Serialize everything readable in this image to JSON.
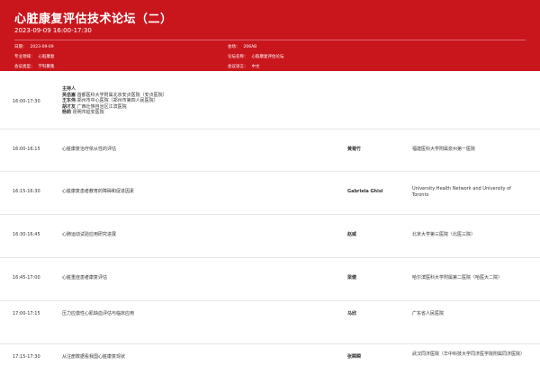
{
  "header": {
    "title": "心脏康复评估技术论坛（二）",
    "datetime": "2023-09-09   16:00-17:30",
    "date_label": "日期：",
    "date_value": "2023-09-09",
    "room_label": "会场：",
    "room_value": "206AB",
    "field_label": "专业领域：",
    "field_value": "心脏康复",
    "forum_label": "论坛名称：",
    "forum_value": "心脏康复评估论坛",
    "type_label": "会议类型：",
    "type_value": "学科聚集",
    "lang_label": "会议语言：",
    "lang_value": "中文"
  },
  "host_block": {
    "time": "16:00-17:30",
    "label": "主持人",
    "hosts": [
      {
        "name": "吴岳嵩",
        "org": "首都医科大学附属北京安贞医院（安贞医院）"
      },
      {
        "name": "王东伟",
        "org": "郑州市中心医院（郑州市第四人民医院）"
      },
      {
        "name": "胡才友",
        "org": "广西壮族自治区江滨医院"
      },
      {
        "name": "杨莉",
        "org": "昆明市延安医院"
      }
    ]
  },
  "sessions": [
    {
      "time": "16:00-16:15",
      "topic": "心脏康复治疗依从性的评估",
      "speaker": "黄菊竹",
      "institution": "福建医科大学附属泉州第一医院"
    },
    {
      "time": "16:15-16:30",
      "topic": "心脏康复患者教育的障碍和促进因素",
      "speaker": "Gabriela Ghisi",
      "institution": "University Health Network and University of Toronto"
    },
    {
      "time": "16:30-16:45",
      "topic": "心肺运动试验应用研究进展",
      "speaker": "赵威",
      "institution": "北京大学第三医院（北医三院）"
    },
    {
      "time": "16:45-17:00",
      "topic": "心脏重症患者康复评估",
      "speaker": "梁健",
      "institution": "哈尔滨医科大学附属第二医院（哈医大二院）"
    },
    {
      "time": "17:00-17:15",
      "topic": "压力应激性心肌缺血评估与临床应用",
      "speaker": "马欣",
      "institution": "广东省人民医院"
    },
    {
      "time": "17:15-17:30",
      "topic": "从注册数据看我国心脏康复现状",
      "speaker": "张瞬瞬",
      "institution": "武汉同济医院（华中科技大学同济医学院附属同济医院）"
    }
  ]
}
